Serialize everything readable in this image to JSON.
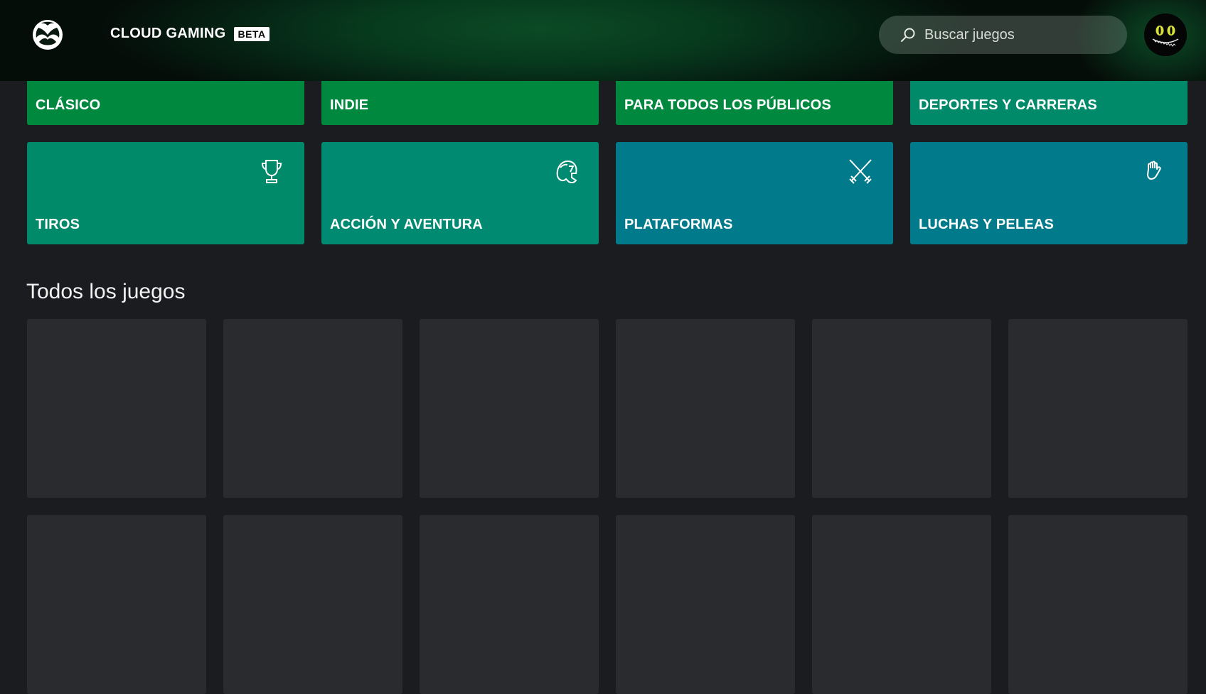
{
  "header": {
    "logo_icon": "xbox-logo-icon",
    "title": "CLOUD GAMING",
    "badge": "BETA",
    "search": {
      "placeholder": "Buscar juegos",
      "icon": "search-icon"
    },
    "avatar_icon": "cat-grin-avatar"
  },
  "genres_top": [
    {
      "label": "CLÁSICO",
      "color": "#01883f"
    },
    {
      "label": "INDIE",
      "color": "#01883f"
    },
    {
      "label": "PARA TODOS LOS PÚBLICOS",
      "color": "#01883f"
    },
    {
      "label": "DEPORTES Y CARRERAS",
      "color": "#008a6a"
    }
  ],
  "genres": [
    {
      "label": "TIROS",
      "icon": "trophy-icon",
      "color": "#008a6a"
    },
    {
      "label": "ACCIÓN Y AVENTURA",
      "icon": "spartan-helmet-icon",
      "color": "#008a72"
    },
    {
      "label": "PLATAFORMAS",
      "icon": "crossed-swords-icon",
      "color": "#017b8b"
    },
    {
      "label": "LUCHAS Y PELEAS",
      "icon": "fist-icon",
      "color": "#017b8b"
    }
  ],
  "all_games": {
    "title": "Todos los juegos",
    "placeholder_count": 12,
    "card_color": "#2a2b2f"
  }
}
